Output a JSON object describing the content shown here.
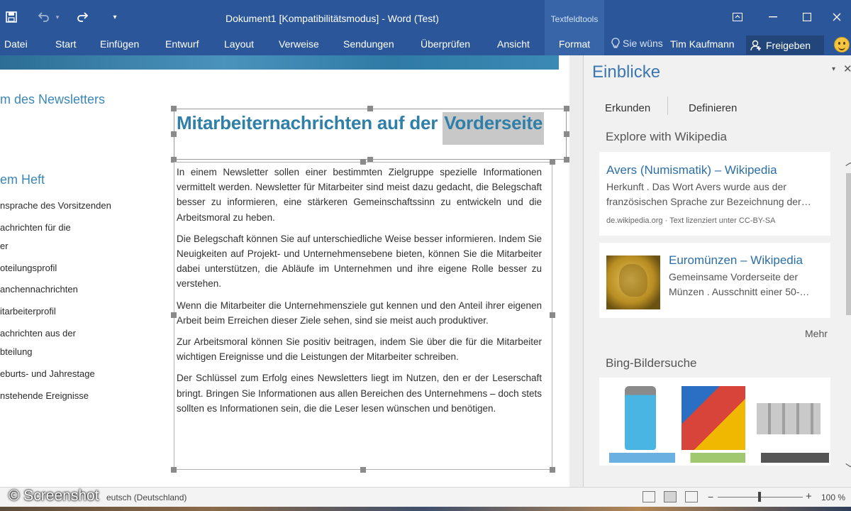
{
  "app": {
    "title": "Dokument1 [Kompatibilitätsmodus] - Word (Test)",
    "context_group": "Textfeldtools",
    "accent": "#2b579a"
  },
  "quick_access": {
    "icons": [
      "save-icon",
      "undo-icon",
      "redo-icon",
      "customize-icon"
    ]
  },
  "window_controls": [
    "ribbon-display-icon",
    "minimize-icon",
    "maximize-icon",
    "close-icon"
  ],
  "ribbon": {
    "tabs": [
      "Datei",
      "Start",
      "Einfügen",
      "Entwurf",
      "Layout",
      "Verweise",
      "Sendungen",
      "Überprüfen",
      "Ansicht",
      "Format"
    ],
    "active_tab": "Format",
    "tell_me": "Sie wüns",
    "user": "Tim Kaufmann",
    "share": "Freigeben"
  },
  "document": {
    "side_headings": [
      "m des Newsletters",
      "em Heft"
    ],
    "toc": [
      "nsprache des Vorsitzenden",
      "achrichten für die",
      "er",
      "oteilungsprofil",
      "anchennachrichten",
      "itarbeiterprofil",
      "achrichten aus der",
      "bteilung",
      "eburts- und Jahrestage",
      "nstehende Ereignisse"
    ],
    "title_main": "Mitarbeiternachrichten auf der ",
    "title_selected": "Vorderseite",
    "paragraphs": [
      "In einem Newsletter sollen einer bestimmten Zielgruppe spezielle Informationen vermittelt werden. Newsletter für Mitarbeiter sind meist dazu gedacht, die Belegschaft besser zu informieren, eine stärkeren Gemeinschaftssinn zu entwickeln und die Arbeitsmoral zu heben.",
      "Die Belegschaft können Sie auf unterschiedliche Weise besser informieren. Indem Sie Neuigkeiten auf Projekt- und Unternehmensebene bieten, können Sie die Mitarbeiter dabei unterstützen, die Abläufe im Unternehmen und ihre eigene Rolle besser zu verstehen.",
      "Wenn die Mitarbeiter die Unternehmensziele gut kennen und den Anteil ihrer eigenen Arbeit beim Erreichen dieser Ziele sehen, sind sie meist auch produktiver.",
      "Zur Arbeitsmoral können Sie positiv beitragen, indem Sie über die für die Mitarbeiter wichtigen Ereignisse und die Leistungen der Mitarbeiter schreiben.",
      "Der Schlüssel zum Erfolg eines Newsletters liegt im Nutzen, den er der Leserschaft bringt. Bringen Sie Informationen aus allen Bereichen des Unternehmens – doch stets sollten es Informationen sein, die die Leser lesen wünschen und benötigen."
    ]
  },
  "insights": {
    "title": "Einblicke",
    "tabs": [
      "Erkunden",
      "Definieren"
    ],
    "section_wiki": "Explore with Wikipedia",
    "card1": {
      "title": "Avers (Numismatik) – Wikipedia",
      "text": "Herkunft . Das Wort Avers wurde aus der französischen Sprache zur Bezeichnung der…",
      "meta": "de.wikipedia.org · Text lizenziert unter CC-BY-SA"
    },
    "card2": {
      "title": "Euromünzen – Wikipedia",
      "text": "Gemeinsame Vorderseite der Münzen . Ausschnitt einer 50-…"
    },
    "more": "Mehr",
    "section_bing": "Bing-Bildersuche"
  },
  "status_bar": {
    "language": "eutsch (Deutschland)",
    "watermark": "© Screenshot",
    "zoom": "100 %",
    "zoom_level": 100
  }
}
